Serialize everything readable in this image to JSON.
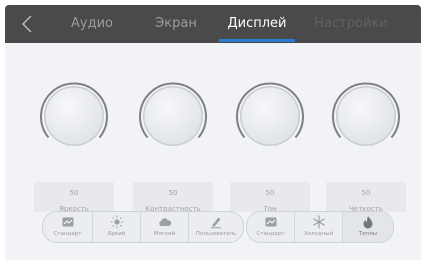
{
  "header": {
    "tabs": [
      {
        "label": "Аудио"
      },
      {
        "label": "Экран"
      },
      {
        "label": "Дисплей"
      },
      {
        "label": "Настройки"
      }
    ],
    "active_tab": "Дисплей"
  },
  "knobs": [
    {
      "label": "Яркость",
      "value": "50"
    },
    {
      "label": "Контрастность",
      "value": "50"
    },
    {
      "label": "Тон",
      "value": "50"
    },
    {
      "label": "Четкость",
      "value": "50"
    }
  ],
  "picture_modes": [
    {
      "label": "Стандарт",
      "icon": "picture-icon"
    },
    {
      "label": "Яркий",
      "icon": "sun-icon"
    },
    {
      "label": "Мягкий",
      "icon": "cloud-icon"
    },
    {
      "label": "Пользователь",
      "icon": "edit-icon"
    }
  ],
  "color_temp_modes": [
    {
      "label": "Стандарт",
      "icon": "picture-icon"
    },
    {
      "label": "Холодный",
      "icon": "snowflake-icon"
    },
    {
      "label": "Теплы",
      "icon": "flame-icon"
    }
  ],
  "colors": {
    "header_bg": "#4a4a4a",
    "tab_active": "#ffffff",
    "tab_inactive": "#9c9c9c",
    "accent": "#2a7bd3",
    "content_bg": "#f1f3f6"
  }
}
